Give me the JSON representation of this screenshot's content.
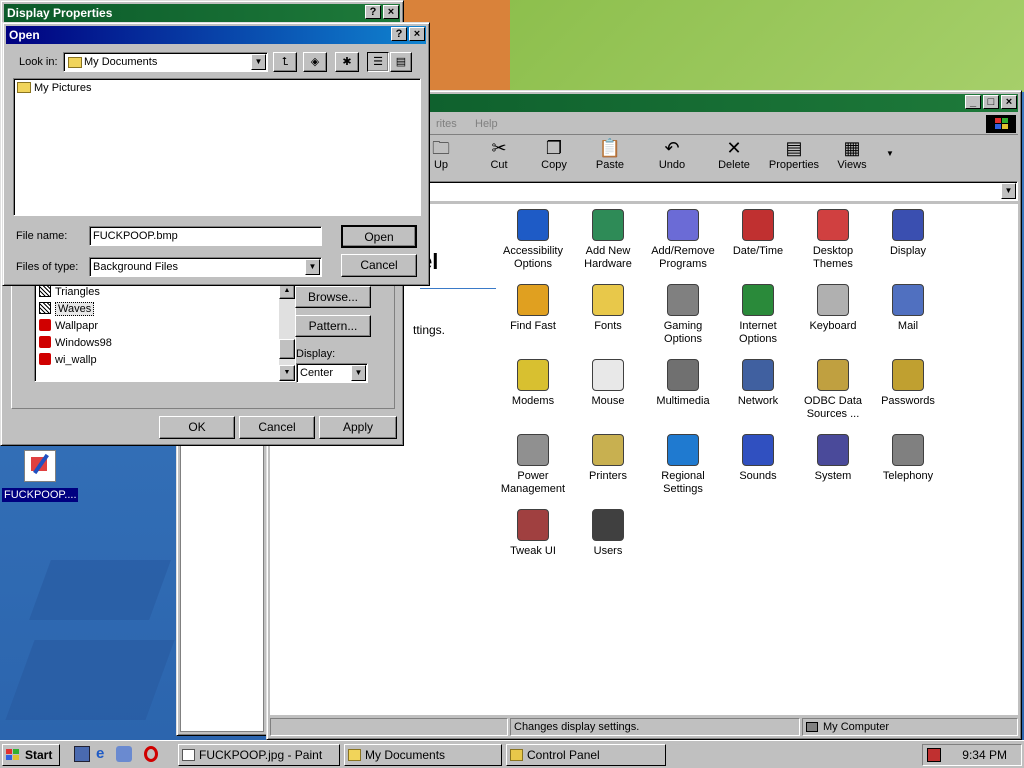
{
  "colors": {
    "title_active": "#000080",
    "desktop": "#2f6fb6",
    "face": "#c0c0c0"
  },
  "display_properties": {
    "title": "Display Properties",
    "help_btn": "?",
    "close_btn": "×",
    "wallpapers": [
      "Triangles",
      "Waves",
      "Wallpapr",
      "Windows98",
      "wi_wallp"
    ],
    "browse": "Browse...",
    "pattern": "Pattern...",
    "display_label": "Display:",
    "display_value": "Center",
    "ok": "OK",
    "cancel": "Cancel",
    "apply": "Apply"
  },
  "open_dialog": {
    "title": "Open",
    "help_btn": "?",
    "close_btn": "×",
    "look_in_label": "Look in:",
    "look_in_value": "My Documents",
    "items": [
      "My Pictures"
    ],
    "file_name_label": "File name:",
    "file_name_value": "FUCKPOOP.bmp",
    "files_of_type_label": "Files of type:",
    "files_of_type_value": "Background Files",
    "open_btn": "Open",
    "cancel_btn": "Cancel"
  },
  "control_panel": {
    "menu_partial": [
      "rites",
      "Help"
    ],
    "toolbar": [
      "Up",
      "Cut",
      "Copy",
      "Paste",
      "Undo",
      "Delete",
      "Properties",
      "Views"
    ],
    "heading_partial": "el",
    "desc_partial": "ttings.",
    "items": [
      {
        "label": "Accessibility Options",
        "icon": "accessibility-icon",
        "color": "#1e5bc6"
      },
      {
        "label": "Add New Hardware",
        "icon": "hardware-icon",
        "color": "#2e8b57"
      },
      {
        "label": "Add/Remove Programs",
        "icon": "programs-icon",
        "color": "#6b6bd6"
      },
      {
        "label": "Date/Time",
        "icon": "clock-icon",
        "color": "#c03030"
      },
      {
        "label": "Desktop Themes",
        "icon": "themes-icon",
        "color": "#d04040"
      },
      {
        "label": "Display",
        "icon": "display-icon",
        "color": "#3a4fb0"
      },
      {
        "label": "Find Fast",
        "icon": "find-fast-icon",
        "color": "#e0a020"
      },
      {
        "label": "Fonts",
        "icon": "fonts-icon",
        "color": "#e8c84a"
      },
      {
        "label": "Gaming Options",
        "icon": "joystick-icon",
        "color": "#808080"
      },
      {
        "label": "Internet Options",
        "icon": "globe-icon",
        "color": "#2a8a3a"
      },
      {
        "label": "Keyboard",
        "icon": "keyboard-icon",
        "color": "#b0b0b0"
      },
      {
        "label": "Mail",
        "icon": "mail-icon",
        "color": "#5070c0"
      },
      {
        "label": "Modems",
        "icon": "modem-icon",
        "color": "#d8c030"
      },
      {
        "label": "Mouse",
        "icon": "mouse-icon",
        "color": "#e8e8e8"
      },
      {
        "label": "Multimedia",
        "icon": "multimedia-icon",
        "color": "#707070"
      },
      {
        "label": "Network",
        "icon": "network-icon",
        "color": "#4060a0"
      },
      {
        "label": "ODBC Data Sources ...",
        "icon": "odbc-icon",
        "color": "#c0a040"
      },
      {
        "label": "Passwords",
        "icon": "keys-icon",
        "color": "#c0a030"
      },
      {
        "label": "Power Management",
        "icon": "power-icon",
        "color": "#909090"
      },
      {
        "label": "Printers",
        "icon": "printers-icon",
        "color": "#c8b050"
      },
      {
        "label": "Regional Settings",
        "icon": "globe-regional-icon",
        "color": "#1f7ad0"
      },
      {
        "label": "Sounds",
        "icon": "sounds-icon",
        "color": "#3050c0"
      },
      {
        "label": "System",
        "icon": "system-icon",
        "color": "#4a4a9a"
      },
      {
        "label": "Telephony",
        "icon": "telephony-icon",
        "color": "#808080"
      },
      {
        "label": "Tweak UI",
        "icon": "tweakui-icon",
        "color": "#a04040"
      },
      {
        "label": "Users",
        "icon": "users-icon",
        "color": "#404040"
      }
    ],
    "status_text": "Changes display settings.",
    "status_location": "My Computer"
  },
  "desktop": {
    "icon_label": "FUCKPOOP...."
  },
  "taskbar": {
    "start": "Start",
    "tasks": [
      "FUCKPOOP.jpg - Paint",
      "My Documents",
      "Control Panel"
    ],
    "time": "9:34 PM"
  }
}
